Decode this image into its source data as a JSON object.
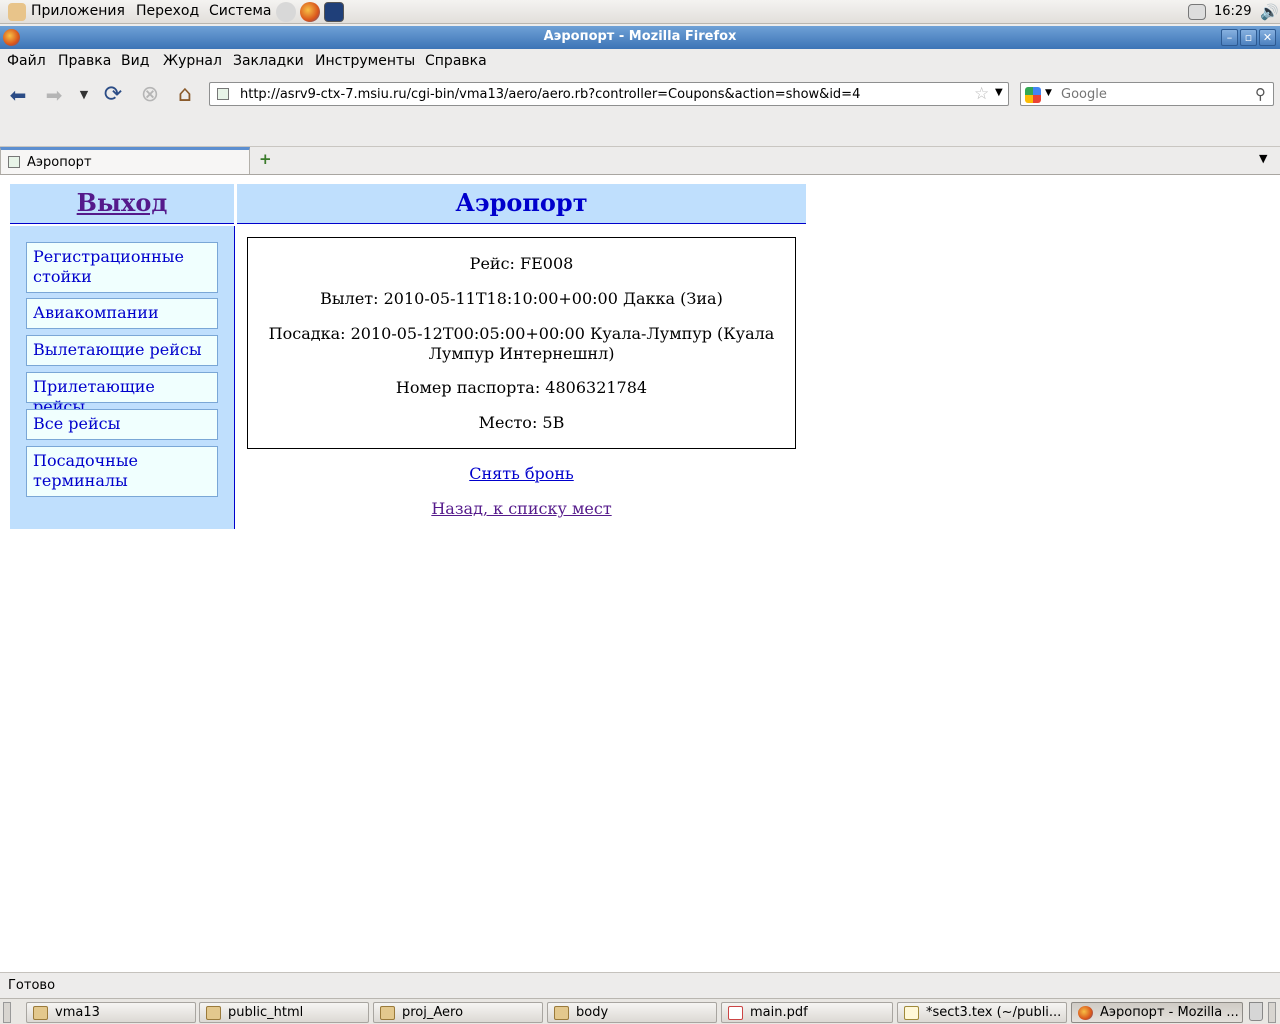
{
  "panel": {
    "menus": [
      "Приложения",
      "Переход",
      "Система"
    ],
    "clock": "16:29"
  },
  "window": {
    "title": "Аэропорт - Mozilla Firefox"
  },
  "menubar": [
    "Файл",
    "Правка",
    "Вид",
    "Журнал",
    "Закладки",
    "Инструменты",
    "Справка"
  ],
  "navbar": {
    "url": "http://asrv9-ctx-7.msiu.ru/cgi-bin/vma13/aero/aero.rb?controller=Coupons&action=show&id=4",
    "search_placeholder": "Google"
  },
  "tabs": [
    {
      "label": "Аэропорт"
    }
  ],
  "page": {
    "logout_label": "Выход",
    "title": "Аэропорт",
    "sidebar": [
      {
        "label": "Регистрационные стойки"
      },
      {
        "label": "Авиакомпании"
      },
      {
        "label": "Вылетающие рейсы"
      },
      {
        "label": "Прилетающие рейсы"
      },
      {
        "label": "Все рейсы"
      },
      {
        "label": "Посадочные терминалы"
      }
    ],
    "flight": "Рейс: FE008",
    "departure": "Вылет: 2010-05-11T18:10:00+00:00 Дакка (Зиа)",
    "arrival": "Посадка: 2010-05-12T00:05:00+00:00 Куала-Лумпур (Куала Лумпур Интернешнл)",
    "passport": "Номер паспорта: 4806321784",
    "seat": "Место: 5B",
    "cancel_link": "Снять бронь",
    "back_link": "Назад, к списку мест"
  },
  "status": "Готово",
  "taskbar": [
    {
      "label": "vma13",
      "icon": "folder-icon"
    },
    {
      "label": "public_html",
      "icon": "folder-icon"
    },
    {
      "label": "proj_Aero",
      "icon": "folder-icon"
    },
    {
      "label": "body",
      "icon": "folder-icon"
    },
    {
      "label": "main.pdf",
      "icon": "pdf-icon"
    },
    {
      "label": "*sect3.tex (~/publi...",
      "icon": "text-editor-icon"
    },
    {
      "label": "Аэропорт - Mozilla ...",
      "icon": "firefox-icon"
    }
  ]
}
